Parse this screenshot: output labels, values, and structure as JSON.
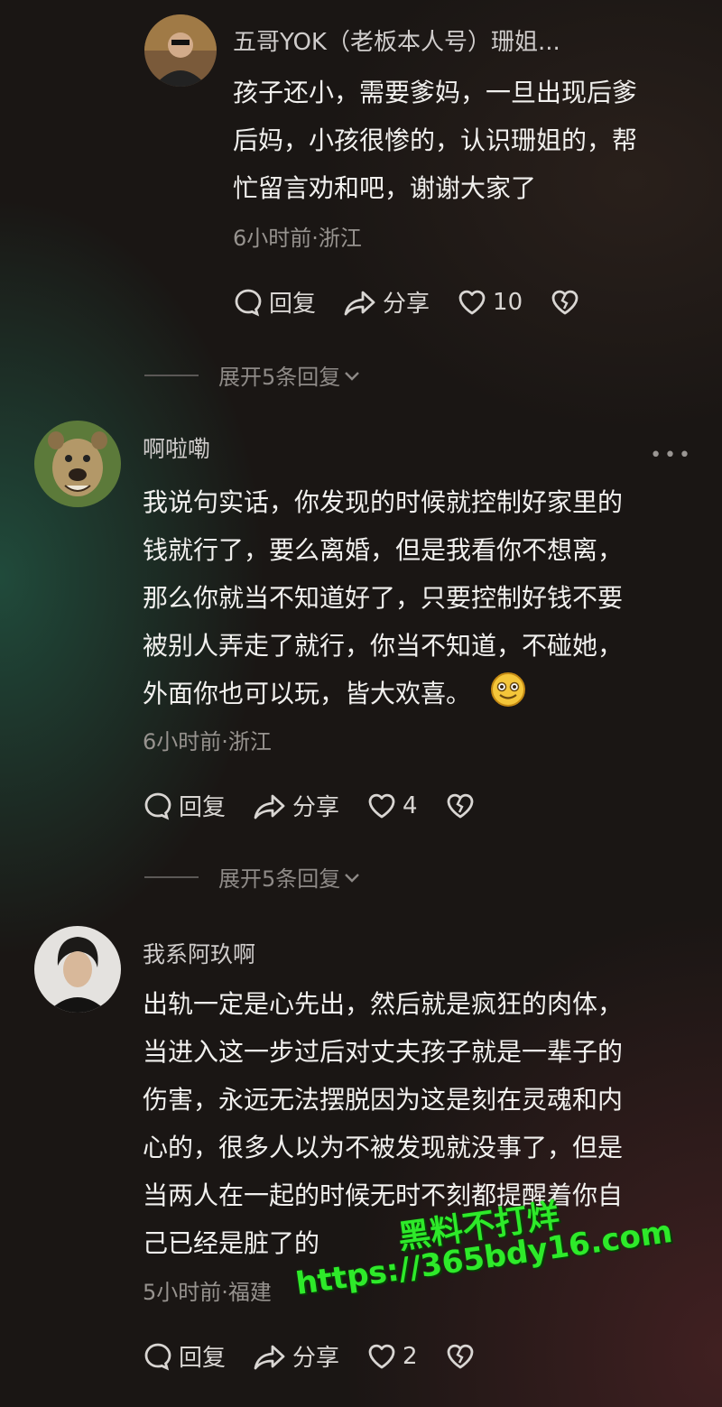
{
  "comments": [
    {
      "username": "五哥YOK（老板本人号）珊姐...",
      "lines": [
        "孩子还小，需要爹妈，一旦出现后爹",
        "后妈，小孩很惨的，认识珊姐的，帮",
        "忙留言劝和吧，谢谢大家了"
      ],
      "time": "6小时前·浙江",
      "reply_label": "回复",
      "share_label": "分享",
      "likes": "10",
      "expand_label": "展开5条回复"
    },
    {
      "username": "啊啦嘞",
      "lines": [
        "我说句实话，你发现的时候就控制好家里的",
        "钱就行了，要么离婚，但是我看你不想离，",
        "那么你就当不知道好了，只要控制好钱不要",
        "被别人弄走了就行，你当不知道，不碰她，",
        "外面你也可以玩，皆大欢喜。"
      ],
      "time": "6小时前·浙江",
      "reply_label": "回复",
      "share_label": "分享",
      "likes": "4",
      "expand_label": "展开5条回复",
      "more_label": "•••"
    },
    {
      "username": "我系阿玖啊",
      "lines": [
        "出轨一定是心先出，然后就是疯狂的肉体，",
        "当进入这一步过后对丈夫孩子就是一辈子的",
        "伤害，永远无法摆脱因为这是刻在灵魂和内",
        "心的，很多人以为不被发现就没事了，但是",
        "当两人在一起的时候无时不刻都提醒着你自",
        "己已经是脏了的"
      ],
      "time": "5小时前·福建",
      "reply_label": "回复",
      "share_label": "分享",
      "likes": "2"
    }
  ],
  "watermark": {
    "line1": "黑料不打烊",
    "line2": "https://365bdy16.com",
    "color": "#2eea2a"
  }
}
